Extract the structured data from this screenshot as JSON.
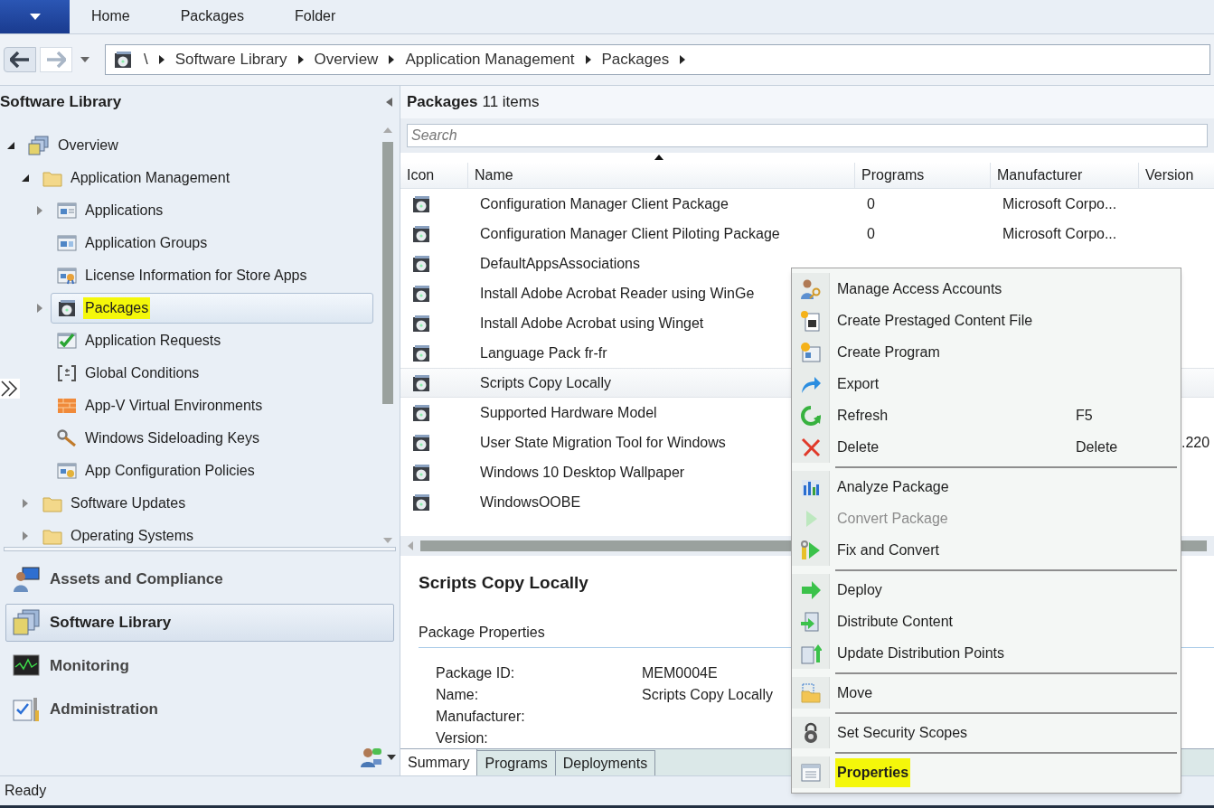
{
  "ribbon_tabs": [
    {
      "label": "Home"
    },
    {
      "label": "Packages"
    },
    {
      "label": "Folder"
    }
  ],
  "breadcrumbs": [
    "\\",
    "Software Library",
    "Overview",
    "Application Management",
    "Packages"
  ],
  "navigation_pane": {
    "title": "Software Library",
    "tree": [
      {
        "label": "Overview",
        "expanded": true,
        "selected": false,
        "highlighted": false,
        "children": [
          {
            "label": "Application Management",
            "expanded": true,
            "selected": false,
            "highlighted": false,
            "children": [
              {
                "label": "Applications",
                "expanded": false,
                "selected": false,
                "highlighted": false
              },
              {
                "label": "Application Groups",
                "selected": false,
                "highlighted": false
              },
              {
                "label": "License Information for Store Apps",
                "selected": false,
                "highlighted": false
              },
              {
                "label": "Packages",
                "expanded": false,
                "selected": true,
                "highlighted": true
              },
              {
                "label": "Application Requests",
                "selected": false,
                "highlighted": false
              },
              {
                "label": "Global Conditions",
                "selected": false,
                "highlighted": false
              },
              {
                "label": "App-V Virtual Environments",
                "selected": false,
                "highlighted": false
              },
              {
                "label": "Windows Sideloading Keys",
                "selected": false,
                "highlighted": false
              },
              {
                "label": "App Configuration Policies",
                "selected": false,
                "highlighted": false
              }
            ]
          },
          {
            "label": "Software Updates",
            "expanded": false,
            "selected": false,
            "highlighted": false
          },
          {
            "label": "Operating Systems",
            "expanded": false,
            "selected": false,
            "highlighted": false
          }
        ]
      }
    ],
    "workspaces": [
      {
        "label": "Assets and Compliance",
        "selected": false
      },
      {
        "label": "Software Library",
        "selected": true
      },
      {
        "label": "Monitoring",
        "selected": false
      },
      {
        "label": "Administration",
        "selected": false
      }
    ]
  },
  "list": {
    "title": "Packages",
    "count": "11 items",
    "search": {
      "placeholder": "Search"
    },
    "columns": [
      "Icon",
      "Name",
      "Programs",
      "Manufacturer",
      "Version"
    ],
    "rows": [
      {
        "name": "Configuration Manager Client Package",
        "programs": "0",
        "manufacturer": "Microsoft Corpo...",
        "selected": false
      },
      {
        "name": "Configuration Manager Client Piloting Package",
        "programs": "0",
        "manufacturer": "Microsoft Corpo...",
        "selected": false
      },
      {
        "name": "DefaultAppsAssociations",
        "selected": false
      },
      {
        "name": "Install Adobe Acrobat Reader using WinGe",
        "selected": false
      },
      {
        "name": "Install Adobe Acrobat using Winget",
        "selected": false
      },
      {
        "name": "Language Pack fr-fr",
        "selected": false
      },
      {
        "name": "Scripts Copy Locally",
        "selected": true
      },
      {
        "name": "Supported Hardware Model",
        "selected": false
      },
      {
        "name": "User State Migration Tool for Windows",
        "version": ".220",
        "selected": false
      },
      {
        "name": "Windows 10 Desktop Wallpaper",
        "selected": false
      },
      {
        "name": "WindowsOOBE",
        "selected": false
      }
    ]
  },
  "details": {
    "title": "Scripts Copy Locally",
    "section": "Package Properties",
    "properties": [
      {
        "label": "Package ID:",
        "value": "MEM0004E"
      },
      {
        "label": "Name:",
        "value": "Scripts Copy Locally"
      },
      {
        "label": "Manufacturer:"
      },
      {
        "label": "Version:"
      }
    ],
    "tabs": [
      {
        "label": "Summary",
        "selected": true
      },
      {
        "label": "Programs",
        "selected": false
      },
      {
        "label": "Deployments",
        "selected": false
      }
    ]
  },
  "context_menu": [
    {
      "kind": "item",
      "label": "Manage Access Accounts",
      "disabled": false,
      "highlighted": false
    },
    {
      "kind": "item",
      "label": "Create Prestaged Content File",
      "disabled": false,
      "highlighted": false
    },
    {
      "kind": "item",
      "label": "Create Program",
      "disabled": false,
      "highlighted": false
    },
    {
      "kind": "item",
      "label": "Export",
      "disabled": false,
      "highlighted": false
    },
    {
      "kind": "item",
      "label": "Refresh",
      "shortcut": "F5",
      "disabled": false,
      "highlighted": false
    },
    {
      "kind": "item",
      "label": "Delete",
      "shortcut": "Delete",
      "disabled": false,
      "highlighted": false
    },
    {
      "kind": "separator"
    },
    {
      "kind": "item",
      "label": "Analyze Package",
      "disabled": false,
      "highlighted": false
    },
    {
      "kind": "item",
      "label": "Convert Package",
      "disabled": true,
      "highlighted": false
    },
    {
      "kind": "item",
      "label": "Fix and Convert",
      "disabled": false,
      "highlighted": false
    },
    {
      "kind": "separator"
    },
    {
      "kind": "item",
      "label": "Deploy",
      "disabled": false,
      "highlighted": false
    },
    {
      "kind": "item",
      "label": "Distribute Content",
      "disabled": false,
      "highlighted": false
    },
    {
      "kind": "item",
      "label": "Update Distribution Points",
      "disabled": false,
      "highlighted": false
    },
    {
      "kind": "separator"
    },
    {
      "kind": "item",
      "label": "Move",
      "disabled": false,
      "highlighted": false
    },
    {
      "kind": "separator"
    },
    {
      "kind": "item",
      "label": "Set Security Scopes",
      "disabled": false,
      "highlighted": false
    },
    {
      "kind": "separator"
    },
    {
      "kind": "item",
      "label": "Properties",
      "disabled": false,
      "highlighted": true
    }
  ],
  "status_bar": "Ready"
}
